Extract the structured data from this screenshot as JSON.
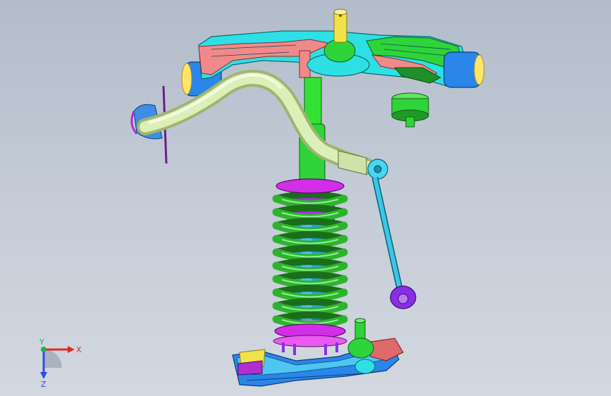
{
  "viewport": {
    "background_top": "#b3bccb",
    "background_bottom": "#d3d8e0"
  },
  "model": {
    "parts": [
      "upper-control-arm",
      "ball-joint-stud",
      "bump-stop-bushing",
      "stabilizer-bar",
      "stabilizer-bracket",
      "stabilizer-end-link",
      "strut-rod",
      "coil-spring",
      "damper-body",
      "spring-seat",
      "lower-control-arm",
      "lower-ball-joint"
    ],
    "colors": {
      "arm_pink": "#f08a8a",
      "arm_cyan": "#2ee0e6",
      "arm_green": "#2fd33a",
      "bushing_blue": "#2a86e8",
      "bar_pale": "#d7ecb0",
      "spring_green": "#2fb32f",
      "damper_blue": "#1fa3ee",
      "seat_magenta": "#d22ee6",
      "link_cyan": "#3cc6e6",
      "joint_purple": "#8a2ee6",
      "stud_yellow": "#f2e24a"
    }
  },
  "triad": {
    "x_label": "X",
    "y_label": "Y",
    "z_label": "Z",
    "x_color": "#e32626",
    "y_color": "#1fb34a",
    "z_color": "#2a4ee6"
  }
}
